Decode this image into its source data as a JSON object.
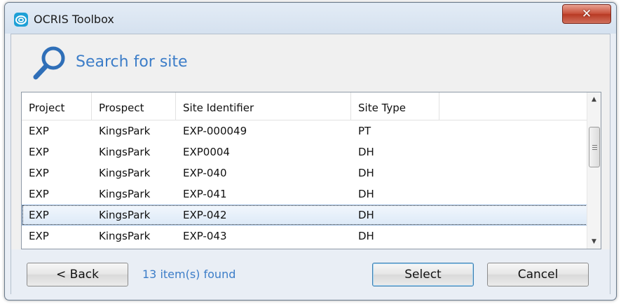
{
  "window": {
    "title": "OCRIS Toolbox",
    "close_label": "✕"
  },
  "header": {
    "title": "Search for site"
  },
  "table": {
    "columns": [
      "Project",
      "Prospect",
      "Site Identifier",
      "Site Type"
    ],
    "rows": [
      [
        "EXP",
        "KingsPark",
        "EXP-000049",
        "PT"
      ],
      [
        "EXP",
        "KingsPark",
        "EXP0004",
        "DH"
      ],
      [
        "EXP",
        "KingsPark",
        "EXP-040",
        "DH"
      ],
      [
        "EXP",
        "KingsPark",
        "EXP-041",
        "DH"
      ],
      [
        "EXP",
        "KingsPark",
        "EXP-042",
        "DH"
      ],
      [
        "EXP",
        "KingsPark",
        "EXP-043",
        "DH"
      ]
    ],
    "selected_row_index": 4
  },
  "footer": {
    "back_label": "< Back",
    "status": "13 item(s) found",
    "select_label": "Select",
    "cancel_label": "Cancel"
  },
  "colors": {
    "accent": "#3c7dc8",
    "selection": "#dce9f7"
  },
  "icons": {
    "app": "ocris-logo-icon",
    "search": "magnifier-icon",
    "close": "close-icon",
    "scroll_up": "arrow-up-icon",
    "scroll_down": "arrow-down-icon"
  }
}
